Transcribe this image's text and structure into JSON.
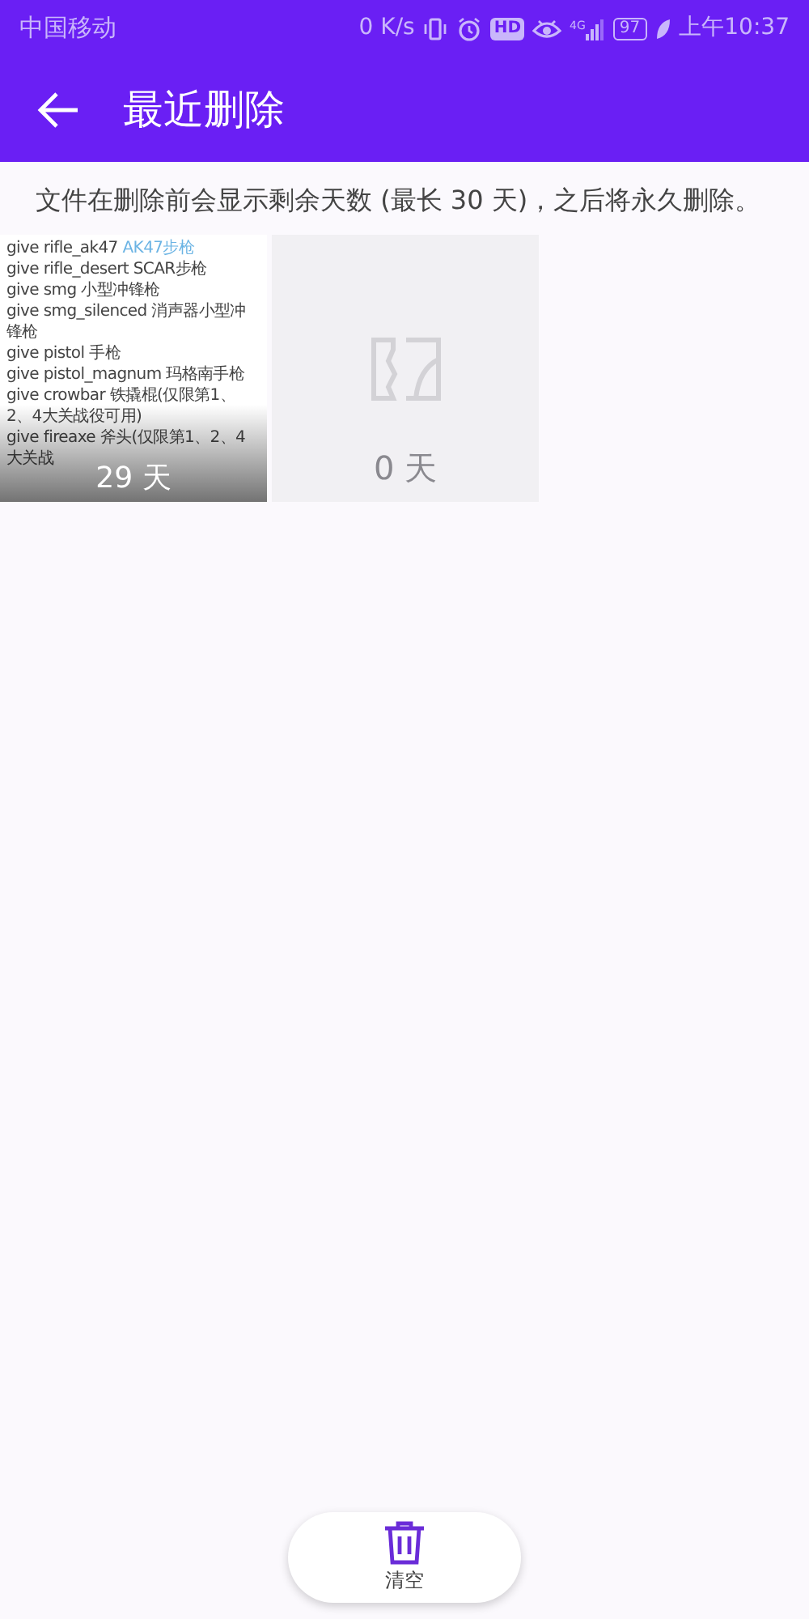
{
  "status_bar": {
    "carrier": "中国移动",
    "speed": "0 K/s",
    "hd": "HD",
    "network": "4G",
    "battery": "97",
    "time": "上午10:37"
  },
  "header": {
    "title": "最近删除"
  },
  "notice": "文件在删除前会显示剩余天数 (最长 30 天)，之后将永久删除。",
  "items": [
    {
      "kind": "document",
      "days": "29 天",
      "lines": [
        {
          "text": "give rifle_ak47",
          "accent": "AK47步枪"
        },
        {
          "text": "give rifle_desert SCAR步枪"
        },
        {
          "text": "give smg 小型冲锋枪"
        },
        {
          "text": "give smg_silenced 消声器小型冲锋枪"
        },
        {
          "text": "give pistol 手枪"
        },
        {
          "text": "give pistol_magnum 玛格南手枪"
        },
        {
          "text": "give crowbar 铁撬棍(仅限第1、2、4大关战役可用)"
        },
        {
          "text": "give fireaxe 斧头(仅限第1、2、4大关战"
        }
      ]
    },
    {
      "kind": "placeholder",
      "days": "0 天"
    }
  ],
  "action": {
    "label": "清空"
  }
}
